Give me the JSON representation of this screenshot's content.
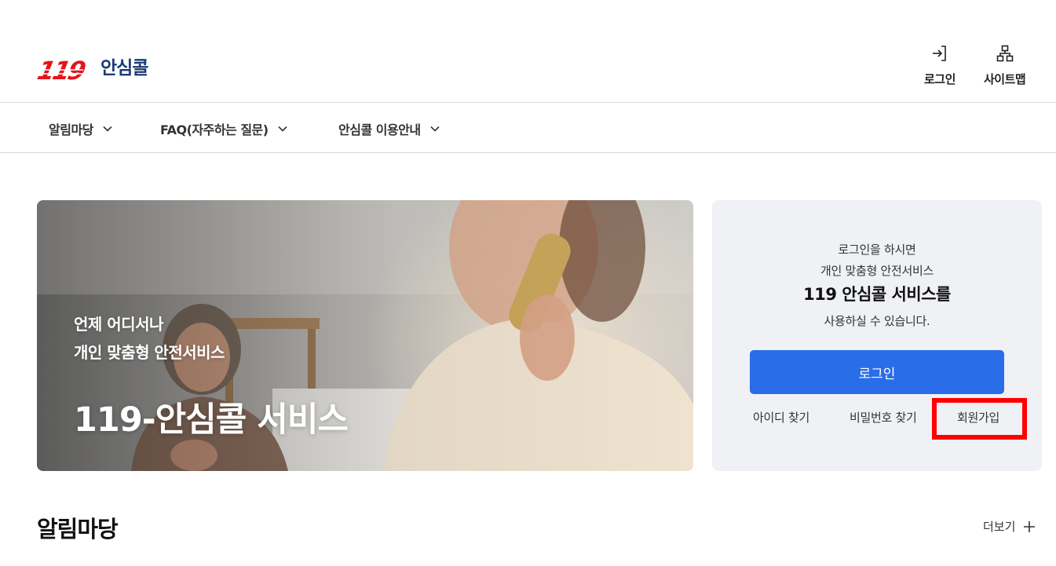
{
  "header": {
    "logo_text": "안심콜",
    "logo_mark_text": "119",
    "login_label": "로그인",
    "sitemap_label": "사이트맵"
  },
  "nav": {
    "items": [
      {
        "label": "알림마당"
      },
      {
        "label": "FAQ(자주하는 질문)"
      },
      {
        "label": "안심콜 이용안내"
      }
    ]
  },
  "hero": {
    "subtitle_line1": "언제 어디서나",
    "subtitle_line2": "개인 맞춤형 안전서비스",
    "title": "119-안심콜 서비스"
  },
  "login_panel": {
    "line1": "로그인을 하시면",
    "line2": "개인 맞춤형 안전서비스",
    "line3": "119 안심콜 서비스를",
    "line4": "사용하실 수 있습니다.",
    "login_button": "로그인",
    "find_id": "아이디 찾기",
    "find_password": "비밀번호 찾기",
    "signup": "회원가입"
  },
  "notice": {
    "title": "알림마당",
    "more": "더보기"
  },
  "colors": {
    "accent": "#2a6de8",
    "brand_red": "#e3151c",
    "brand_navy": "#1b3b73",
    "highlight": "#ff0000",
    "panel_bg": "#eff1f5"
  },
  "icons": {
    "login": "login-arrow-icon",
    "sitemap": "sitemap-icon",
    "nav_chevron": "chevron-down-icon",
    "more": "plus-icon"
  }
}
